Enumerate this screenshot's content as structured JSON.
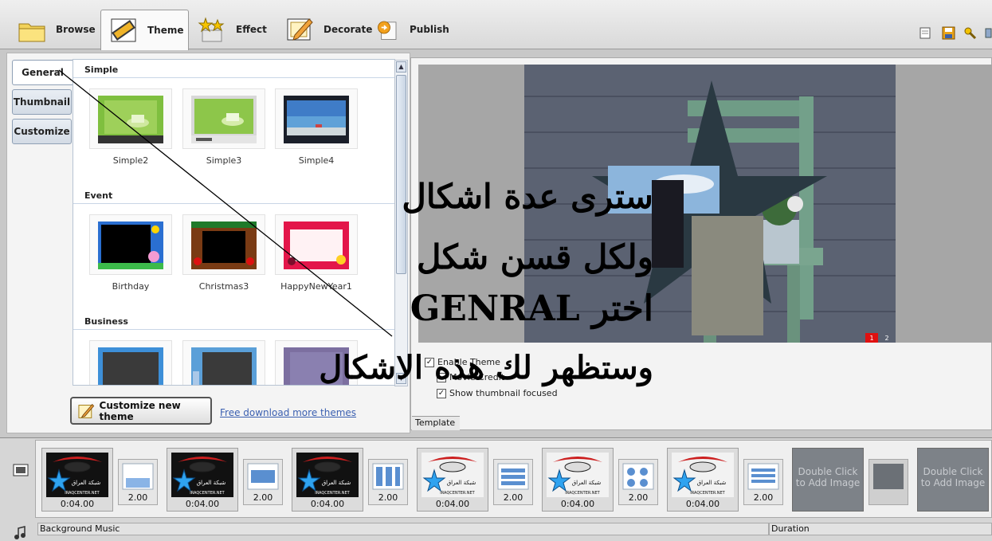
{
  "toolbar": {
    "tabs": [
      {
        "label": "Browse",
        "icon": "folder-icon"
      },
      {
        "label": "Theme",
        "icon": "film-icon",
        "active": true
      },
      {
        "label": "Effect",
        "icon": "stars-icon"
      },
      {
        "label": "Decorate",
        "icon": "pencil-frame-icon"
      },
      {
        "label": "Publish",
        "icon": "publish-icon"
      }
    ],
    "right_icons": [
      "note-icon",
      "save-icon",
      "tools-icon"
    ]
  },
  "left_panel": {
    "tabs": [
      {
        "label": "General",
        "active": true
      },
      {
        "label": "Thumbnail"
      },
      {
        "label": "Customize"
      }
    ],
    "categories": [
      {
        "title": "Simple",
        "items": [
          "Simple2",
          "Simple3",
          "Simple4"
        ]
      },
      {
        "title": "Event",
        "items": [
          "Birthday",
          "Christmas3",
          "HappyNewYear1"
        ]
      },
      {
        "title": "Business",
        "items": [
          "",
          "",
          ""
        ]
      }
    ],
    "customize_button": "Customize new theme",
    "download_link": "Free download more themes"
  },
  "preview": {
    "page_numbers": [
      "1",
      "2"
    ],
    "options": [
      {
        "label": "Enable Theme",
        "checked": true
      },
      {
        "label": "Movie Credit",
        "checked": false
      },
      {
        "label": "Show thumbnail focused",
        "checked": true
      }
    ],
    "tab_label": "Template"
  },
  "annotation": {
    "lines": [
      "سترى عدة اشكال",
      "ولكل قسن شكل",
      "اختر GENRAL",
      "وستظهر لك هذه الاشكال"
    ]
  },
  "timeline": {
    "clip_duration": "0:04.00",
    "transition_duration": "2.00",
    "logo_text": "شبكة العراق",
    "logo_sub": "IRAQCENTER.NET",
    "empty_clip_text": "Double Click to Add Image",
    "background_music_label": "Background Music",
    "duration_label": "Duration"
  },
  "colors": {
    "accent_link": "#3a5fb0",
    "tab_border": "#8fa0b5",
    "timeline_empty": "#7d8288",
    "page_active": "#e01010"
  }
}
